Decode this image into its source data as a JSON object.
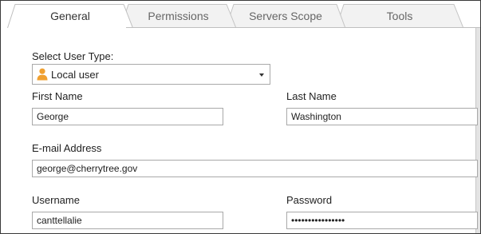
{
  "tabs": [
    {
      "label": "General"
    },
    {
      "label": "Permissions"
    },
    {
      "label": "Servers Scope"
    },
    {
      "label": "Tools"
    }
  ],
  "form": {
    "user_type_label": "Select User Type:",
    "user_type_value": "Local user",
    "first_name_label": "First Name",
    "first_name_value": "George",
    "last_name_label": "Last Name",
    "last_name_value": "Washington",
    "email_label": "E-mail Address",
    "email_value": "george@cherrytree.gov",
    "username_label": "Username",
    "username_value": "canttellalie",
    "password_label": "Password",
    "password_value": "••••••••••••••••"
  },
  "icons": {
    "user_type": "user-icon",
    "dropdown": "caret-down-icon"
  },
  "colors": {
    "user_icon": "#f0a030",
    "active_tab_bg": "#ffffff",
    "inactive_tab_bg": "#f2f2f2",
    "border": "#a9a9a9"
  }
}
